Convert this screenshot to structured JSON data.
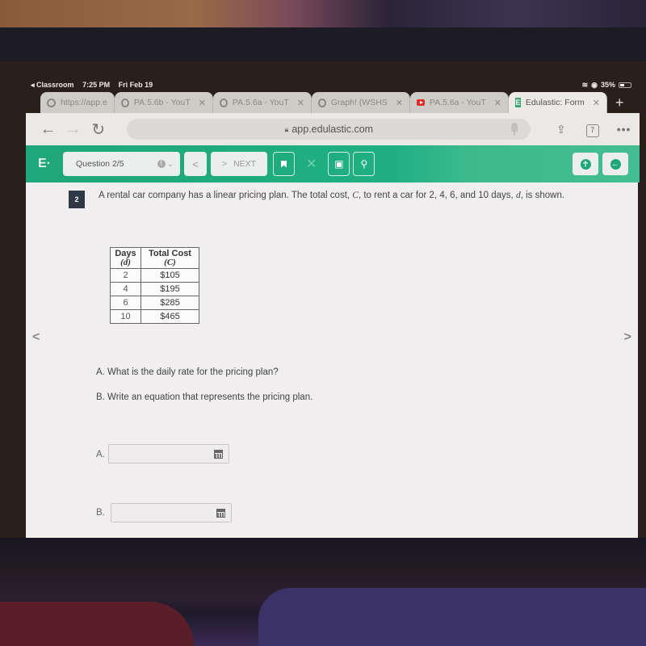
{
  "status_bar": {
    "back_app": "◂ Classroom",
    "time": "7:25 PM",
    "date": "Fri Feb 19",
    "battery": "35%"
  },
  "tabs": [
    {
      "label": "https://app.e",
      "icon": "globe-icon",
      "closable": false,
      "active": false
    },
    {
      "label": "PA.5.6b - YouT",
      "icon": "globe-icon",
      "closable": true,
      "active": false
    },
    {
      "label": "PA.5.6a - YouT",
      "icon": "globe-icon",
      "closable": true,
      "active": false
    },
    {
      "label": "Graph! (WSHS",
      "icon": "globe-icon",
      "closable": true,
      "active": false
    },
    {
      "label": "PA.5.6a - YouT",
      "icon": "youtube-icon",
      "closable": true,
      "active": false
    },
    {
      "label": "Edulastic: Form",
      "icon": "edulastic-icon",
      "closable": true,
      "active": true
    }
  ],
  "new_tab_label": "+",
  "close_glyph": "✕",
  "browser": {
    "url": "app.edulastic.com",
    "tab_count": "7",
    "more_glyph": "•••"
  },
  "header": {
    "logo": "E·",
    "question_selector": "Question 2/5",
    "prev_glyph": "<",
    "next_label": "NEXT",
    "next_glyph": ">"
  },
  "question": {
    "number": "2",
    "stem_prefix": "A rental car company has a linear pricing plan. The total cost, ",
    "stem_var_c": "C",
    "stem_mid": ", to rent a car for  2, 4, 6, and  10 days, ",
    "stem_var_d": "d",
    "stem_suffix": ", is shown.",
    "table": {
      "headers": [
        {
          "label": "Days",
          "var": "(d)"
        },
        {
          "label": "Total Cost",
          "var": "(C)"
        }
      ],
      "rows": [
        {
          "days": "2",
          "cost": "$105"
        },
        {
          "days": "4",
          "cost": "$195"
        },
        {
          "days": "6",
          "cost": "$285"
        },
        {
          "days": "10",
          "cost": "$465"
        }
      ]
    },
    "part_a": "A. What is the daily rate for the pricing plan?",
    "part_b": "B. Write an equation that represents the pricing plan.",
    "answers": [
      {
        "label": "A.",
        "value": ""
      },
      {
        "label": "B.",
        "value": ""
      }
    ]
  },
  "colors": {
    "edulastic_green": "#1fa67a",
    "question_badge": "#2e3846"
  }
}
